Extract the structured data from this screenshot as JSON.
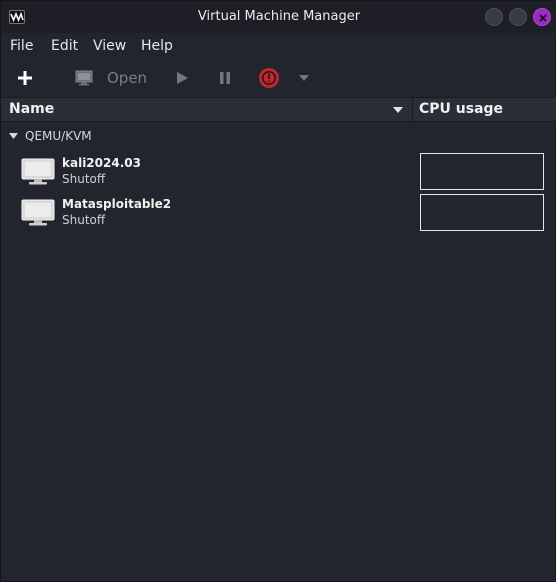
{
  "window": {
    "title": "Virtual Machine Manager",
    "accent_color": "#9b2ac0"
  },
  "menubar": {
    "items": [
      "File",
      "Edit",
      "View",
      "Help"
    ]
  },
  "toolbar": {
    "new_icon": "plus-icon",
    "open_label": "Open",
    "open_icon": "monitor-icon",
    "run_icon": "play-icon",
    "pause_icon": "pause-icon",
    "shutdown_icon": "power-icon",
    "shutdown_color": "#c0282d",
    "menu_icon": "chevron-down-icon"
  },
  "columns": {
    "name": "Name",
    "cpu": "CPU usage"
  },
  "connection": {
    "label": "QEMU/KVM",
    "vms": [
      {
        "name": "kali2024.03",
        "status": "Shutoff"
      },
      {
        "name": "Matasploitable2",
        "status": "Shutoff"
      }
    ]
  }
}
